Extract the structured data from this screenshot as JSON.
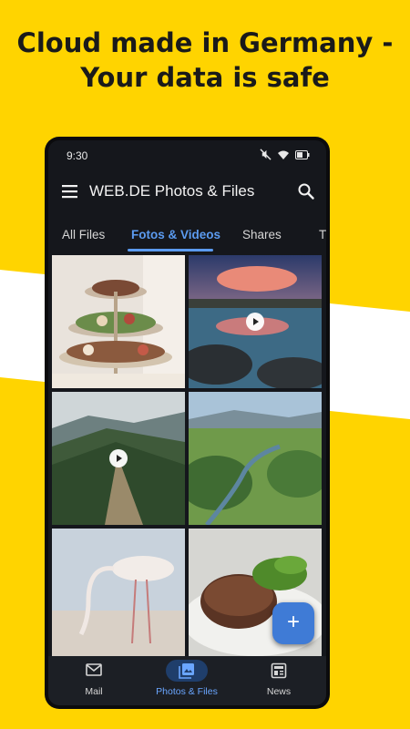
{
  "promo": {
    "headline_line1": "Cloud made in Germany -",
    "headline_line2": "Your data is safe",
    "background_color": "#FFD400"
  },
  "status_bar": {
    "time": "9:30",
    "icons": [
      "mute-icon",
      "wifi-icon",
      "battery-icon"
    ]
  },
  "app_bar": {
    "menu_icon": "hamburger-menu-icon",
    "title": "WEB.DE Photos & Files",
    "search_icon": "search-icon"
  },
  "tabs": [
    {
      "label": "All Files",
      "active": false
    },
    {
      "label": "Fotos & Videos",
      "active": true
    },
    {
      "label": "Shares",
      "active": false
    },
    {
      "label": "T",
      "active": false
    }
  ],
  "grid": {
    "items": [
      {
        "subject": "cake-stand",
        "video": false
      },
      {
        "subject": "lake-sunset",
        "video": true
      },
      {
        "subject": "mountain-ridge",
        "video": true
      },
      {
        "subject": "valley-river",
        "video": false
      },
      {
        "subject": "flamingo",
        "video": false
      },
      {
        "subject": "steak",
        "video": false
      }
    ]
  },
  "fab": {
    "label": "+",
    "icon": "plus-icon"
  },
  "bottom_nav": [
    {
      "label": "Mail",
      "icon": "mail-icon",
      "active": false
    },
    {
      "label": "Photos & Files",
      "icon": "photos-icon",
      "active": true
    },
    {
      "label": "News",
      "icon": "news-icon",
      "active": false
    }
  ],
  "colors": {
    "accent": "#5b9bf0",
    "fab": "#3f7bd6",
    "screen_bg": "#15171c"
  }
}
